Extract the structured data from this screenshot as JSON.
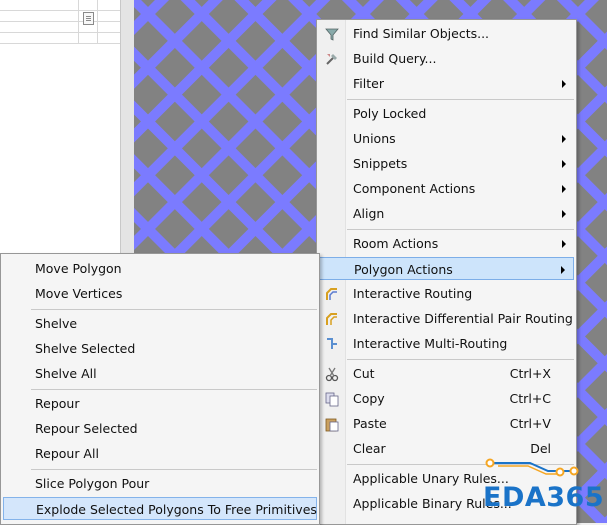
{
  "main_menu": {
    "groups": [
      [
        {
          "label": "Find Similar Objects...",
          "icon": "funnel-icon"
        },
        {
          "label": "Build Query...",
          "icon": "tools-icon"
        },
        {
          "label": "Filter",
          "submenu": true
        }
      ],
      [
        {
          "label": "Poly Locked"
        },
        {
          "label": "Unions",
          "submenu": true
        },
        {
          "label": "Snippets",
          "submenu": true
        },
        {
          "label": "Component Actions",
          "submenu": true
        },
        {
          "label": "Align",
          "submenu": true
        }
      ],
      [
        {
          "label": "Room Actions",
          "submenu": true
        },
        {
          "label": "Polygon Actions",
          "submenu": true,
          "highlighted": true
        },
        {
          "label": "Interactive Routing",
          "icon": "interactive-routing-icon"
        },
        {
          "label": "Interactive Differential Pair Routing",
          "icon": "diff-pair-routing-icon"
        },
        {
          "label": "Interactive Multi-Routing",
          "icon": "multi-routing-icon"
        }
      ],
      [
        {
          "label": "Cut",
          "shortcut": "Ctrl+X",
          "icon": "scissors-icon"
        },
        {
          "label": "Copy",
          "shortcut": "Ctrl+C",
          "icon": "copy-icon"
        },
        {
          "label": "Paste",
          "shortcut": "Ctrl+V",
          "icon": "paste-icon"
        },
        {
          "label": "Clear",
          "shortcut": "Del"
        }
      ],
      [
        {
          "label": "Applicable Unary Rules..."
        },
        {
          "label": "Applicable Binary Rules..."
        }
      ]
    ]
  },
  "sub_menu": {
    "groups": [
      [
        {
          "label": "Move Polygon"
        },
        {
          "label": "Move Vertices"
        }
      ],
      [
        {
          "label": "Shelve"
        },
        {
          "label": "Shelve Selected"
        },
        {
          "label": "Shelve All"
        }
      ],
      [
        {
          "label": "Repour"
        },
        {
          "label": "Repour Selected"
        },
        {
          "label": "Repour All"
        }
      ],
      [
        {
          "label": "Slice Polygon Pour"
        },
        {
          "label": "Explode Selected Polygons To Free Primitives",
          "highlighted": true
        }
      ]
    ]
  },
  "logo": {
    "text": "EDA365"
  },
  "colors": {
    "canvas_blue": "#7b7bff",
    "canvas_gray": "#808080",
    "menu_bg": "#f5f5f5",
    "highlight": "#cde4fb",
    "logo_blue": "#1a73c8",
    "logo_orange": "#f5a623"
  }
}
